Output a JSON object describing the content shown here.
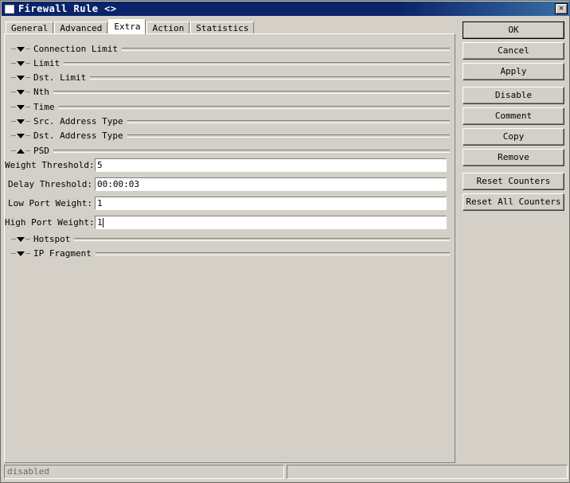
{
  "window": {
    "title": "Firewall Rule <>",
    "icon": "window-icon",
    "close_label": "✕"
  },
  "tabs": [
    {
      "label": "General",
      "selected": false
    },
    {
      "label": "Advanced",
      "selected": false
    },
    {
      "label": "Extra",
      "selected": true
    },
    {
      "label": "Action",
      "selected": false
    },
    {
      "label": "Statistics",
      "selected": false
    }
  ],
  "sections": [
    {
      "label": "Connection Limit",
      "expanded": false,
      "arrow": "chevron-down-icon"
    },
    {
      "label": "Limit",
      "expanded": false,
      "arrow": "chevron-down-icon"
    },
    {
      "label": "Dst. Limit",
      "expanded": false,
      "arrow": "chevron-down-icon"
    },
    {
      "label": "Nth",
      "expanded": false,
      "arrow": "chevron-down-icon"
    },
    {
      "label": "Time",
      "expanded": false,
      "arrow": "chevron-down-icon"
    },
    {
      "label": "Src. Address Type",
      "expanded": false,
      "arrow": "chevron-down-icon"
    },
    {
      "label": "Dst. Address Type",
      "expanded": false,
      "arrow": "chevron-down-icon"
    },
    {
      "label": "PSD",
      "expanded": true,
      "arrow": "chevron-up-icon"
    },
    {
      "label": "Hotspot",
      "expanded": false,
      "arrow": "chevron-down-icon"
    },
    {
      "label": "IP Fragment",
      "expanded": false,
      "arrow": "chevron-down-icon"
    }
  ],
  "psd_fields": [
    {
      "label": "Weight Threshold:",
      "value": "5",
      "focused": false
    },
    {
      "label": "Delay Threshold:",
      "value": "00:00:03",
      "focused": false
    },
    {
      "label": "Low Port Weight:",
      "value": "1",
      "focused": false
    },
    {
      "label": "High Port Weight:",
      "value": "1",
      "focused": true
    }
  ],
  "buttons": [
    {
      "label": "OK",
      "default": true,
      "gap": false
    },
    {
      "label": "Cancel",
      "default": false,
      "gap": false
    },
    {
      "label": "Apply",
      "default": false,
      "gap": false
    },
    {
      "label": "Disable",
      "default": false,
      "gap": true
    },
    {
      "label": "Comment",
      "default": false,
      "gap": false
    },
    {
      "label": "Copy",
      "default": false,
      "gap": false
    },
    {
      "label": "Remove",
      "default": false,
      "gap": false
    },
    {
      "label": "Reset Counters",
      "default": false,
      "gap": true
    },
    {
      "label": "Reset All Counters",
      "default": false,
      "gap": false
    }
  ],
  "statusbar": {
    "left": "disabled",
    "right": ""
  },
  "colors": {
    "face": "#d4d0c8",
    "titlebar": "#0a246a",
    "field_bg": "#ffffff",
    "shadow": "#808080",
    "status_text": "#6b6b63"
  }
}
